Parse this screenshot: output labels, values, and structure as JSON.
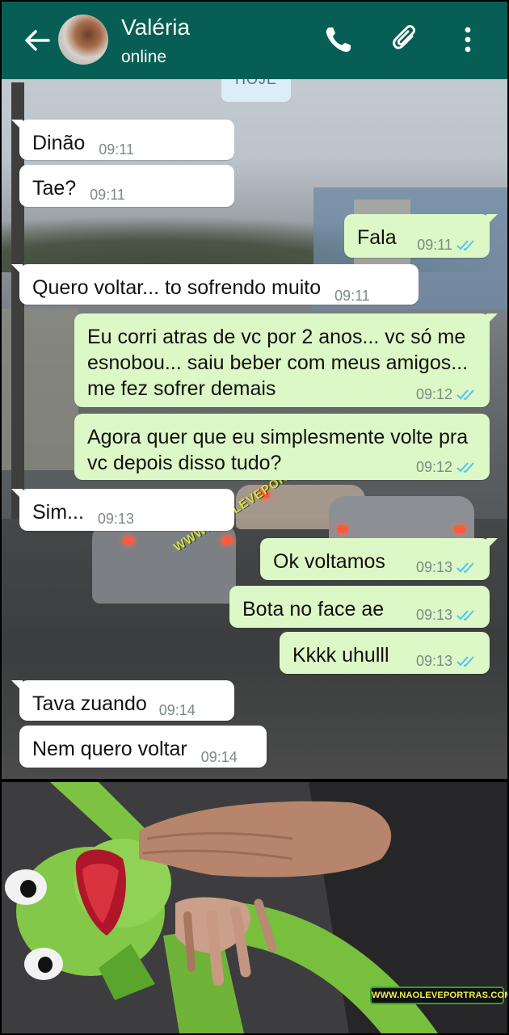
{
  "header": {
    "contact_name": "Valéria",
    "status": "online",
    "icons": [
      "back-arrow-icon",
      "avatar",
      "phone-icon",
      "paperclip-icon",
      "more-vert-icon"
    ]
  },
  "date_chip": "HOJE",
  "messages": [
    {
      "dir": "in",
      "text": "Dinão",
      "time": "09:11"
    },
    {
      "dir": "in",
      "text": "Tae?",
      "time": "09:11"
    },
    {
      "dir": "out",
      "text": "Fala",
      "time": "09:11"
    },
    {
      "dir": "in",
      "text": "Quero voltar... to sofrendo muito",
      "time": "09:11"
    },
    {
      "dir": "out",
      "text": "Eu corri atras de vc por 2 anos... vc só me esnobou... saiu beber com meus amigos... me fez sofrer demais",
      "time": "09:12"
    },
    {
      "dir": "out",
      "text": "Agora quer que eu simplesmente volte pra vc depois disso tudo?",
      "time": "09:12"
    },
    {
      "dir": "in",
      "text": "Sim...",
      "time": "09:13"
    },
    {
      "dir": "out",
      "text": "Ok voltamos",
      "time": "09:13"
    },
    {
      "dir": "out",
      "text": "Bota no face ae",
      "time": "09:13"
    },
    {
      "dir": "out",
      "text": "Kkkk uhulll",
      "time": "09:13"
    },
    {
      "dir": "in",
      "text": "Tava zuando",
      "time": "09:14"
    },
    {
      "dir": "in",
      "text": "Nem quero voltar",
      "time": "09:14"
    }
  ],
  "watermarks": {
    "middle": "WWW.NAOLEVEPORTRAS.COM",
    "bottom": "WWW.NAOLEVEPORTRAS.COM"
  },
  "colors": {
    "appbar": "#075e54",
    "incoming_bubble": "#ffffff",
    "outgoing_bubble": "#dcf8c6",
    "read_ticks": "#4fc3f7",
    "kermit_green": "#7dc242"
  }
}
